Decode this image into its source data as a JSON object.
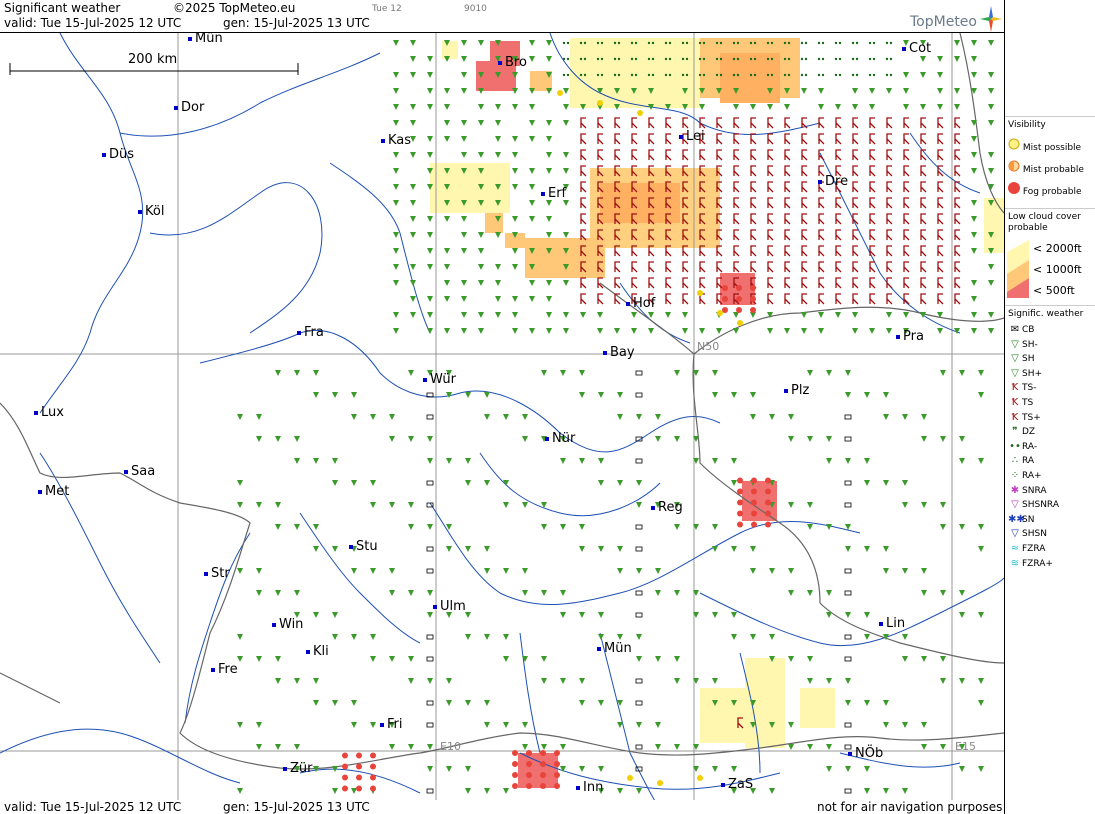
{
  "header": {
    "title": "Significant weather",
    "copyright": "©2025 TopMeteo.eu",
    "small_day": "Tue 12",
    "small_code": "9010",
    "valid": "valid:  Tue  15-Jul-2025  12 UTC",
    "gen": "gen: 15-Jul-2025 13 UTC",
    "logo": "TopMeteo"
  },
  "scale_bar": {
    "label": "200 km"
  },
  "grid_labels": {
    "n50": "N50",
    "e10": "E10",
    "e15": "E15"
  },
  "cities": [
    {
      "name": "Mün",
      "id": "muenster"
    },
    {
      "name": "Bro",
      "id": "brocken"
    },
    {
      "name": "Cot",
      "id": "cottbus"
    },
    {
      "name": "Dor",
      "id": "dortmund"
    },
    {
      "name": "Kas",
      "id": "kassel"
    },
    {
      "name": "Lei",
      "id": "leipzig"
    },
    {
      "name": "Düs",
      "id": "duesseldorf"
    },
    {
      "name": "Dre",
      "id": "dresden"
    },
    {
      "name": "Erf",
      "id": "erfurt"
    },
    {
      "name": "Köl",
      "id": "koeln"
    },
    {
      "name": "Hof",
      "id": "hof"
    },
    {
      "name": "Fra",
      "id": "frankfurt"
    },
    {
      "name": "Pra",
      "id": "praha"
    },
    {
      "name": "Bay",
      "id": "bayreuth"
    },
    {
      "name": "Wür",
      "id": "wuerzburg"
    },
    {
      "name": "Plz",
      "id": "plzen"
    },
    {
      "name": "Lux",
      "id": "luxembourg"
    },
    {
      "name": "Nür",
      "id": "nuernberg"
    },
    {
      "name": "Saa",
      "id": "saarbruecken"
    },
    {
      "name": "Met",
      "id": "metz"
    },
    {
      "name": "Reg",
      "id": "regensburg"
    },
    {
      "name": "Stu",
      "id": "stuttgart"
    },
    {
      "name": "Str",
      "id": "strasbourg"
    },
    {
      "name": "Ulm",
      "id": "ulm"
    },
    {
      "name": "Win",
      "id": "winterthur-de"
    },
    {
      "name": "Lin",
      "id": "linz"
    },
    {
      "name": "Kli",
      "id": "kli"
    },
    {
      "name": "Mün",
      "id": "muenchen"
    },
    {
      "name": "Fre",
      "id": "freiburg"
    },
    {
      "name": "Fri",
      "id": "friedrichshafen"
    },
    {
      "name": "NÖb",
      "id": "noeb"
    },
    {
      "name": "Zür",
      "id": "zuerich"
    },
    {
      "name": "Inn",
      "id": "innsbruck"
    },
    {
      "name": "ZaS",
      "id": "zas"
    }
  ],
  "footer": {
    "valid": "valid:  Tue  15-Jul-2025  12 UTC",
    "gen": "gen: 15-Jul-2025 13 UTC",
    "disclaimer": "not for air navigation purposes"
  },
  "legend": {
    "visibility_title": "Visibility",
    "visibility": [
      {
        "label": "Mist possible",
        "color": "#fff08a"
      },
      {
        "label": "Mist probable",
        "color": "#ff9b3c"
      },
      {
        "label": "Fog probable",
        "color": "#e8443c"
      }
    ],
    "lowcloud_title_1": "Low cloud cover",
    "lowcloud_title_2": "probable",
    "lowcloud": [
      {
        "label": "< 2000ft",
        "color": "#fff6b0"
      },
      {
        "label": "< 1000ft",
        "color": "#ffc878"
      },
      {
        "label": "<   500ft",
        "color": "#f07070"
      }
    ],
    "signif_title": "Signific. weather",
    "signif": [
      {
        "label": "CB",
        "icon": "cb-icon"
      },
      {
        "label": "SH-",
        "icon": "shower-light-icon"
      },
      {
        "label": "SH",
        "icon": "shower-icon"
      },
      {
        "label": "SH+",
        "icon": "shower-heavy-icon"
      },
      {
        "label": "TS-",
        "icon": "thunderstorm-light-icon"
      },
      {
        "label": "TS",
        "icon": "thunderstorm-icon"
      },
      {
        "label": "TS+",
        "icon": "thunderstorm-heavy-icon"
      },
      {
        "label": "DZ",
        "icon": "drizzle-icon"
      },
      {
        "label": "RA-",
        "icon": "rain-light-icon"
      },
      {
        "label": "RA",
        "icon": "rain-icon"
      },
      {
        "label": "RA+",
        "icon": "rain-heavy-icon"
      },
      {
        "label": "SNRA",
        "icon": "snow-rain-icon"
      },
      {
        "label": "SHSNRA",
        "icon": "snow-rain-shower-icon"
      },
      {
        "label": "SN",
        "icon": "snow-icon"
      },
      {
        "label": "SHSN",
        "icon": "snow-shower-icon"
      },
      {
        "label": "FZRA",
        "icon": "freezing-rain-icon"
      },
      {
        "label": "FZRA+",
        "icon": "freezing-rain-heavy-icon"
      }
    ]
  }
}
